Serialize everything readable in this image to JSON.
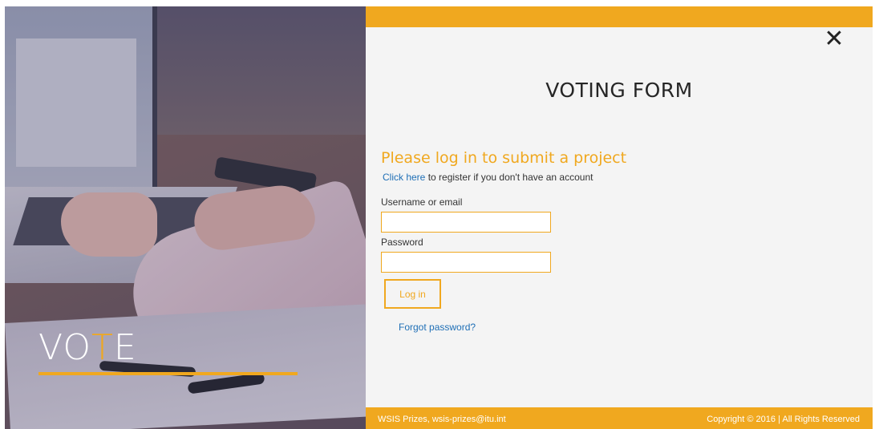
{
  "hero": {
    "title_prefix": "VO",
    "title_accent": "T",
    "title_suffix": "E"
  },
  "modal": {
    "close_icon": "close-icon",
    "close_label": "✕",
    "title": "VOTING FORM",
    "subheading": "Please log in to submit a project",
    "register_link": "Click here",
    "register_text": "to register if you don't have an account",
    "username_label": "Username or email",
    "username_value": "",
    "password_label": "Password",
    "password_value": "",
    "login_button": "Log in",
    "forgot_link": "Forgot password?"
  },
  "footer": {
    "left": "WSIS Prizes, wsis-prizes@itu.int",
    "right": "Copyright © 2016 | All Rights Reserved"
  },
  "colors": {
    "accent": "#f0a81f",
    "link": "#1f6fb6",
    "panel_bg": "#f4f4f4"
  }
}
